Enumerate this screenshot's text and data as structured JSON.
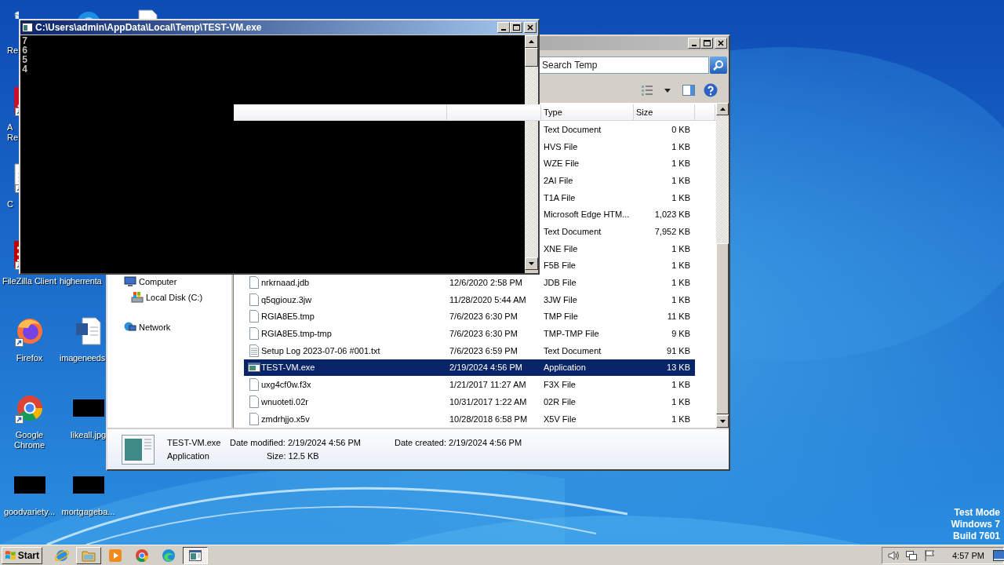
{
  "desktop": {
    "icons": [
      {
        "kind": "recycle-bin",
        "lines": [
          "Re"
        ],
        "clipped": true,
        "shortcut": false
      },
      {
        "kind": "blue-app",
        "shortcut": false
      },
      {
        "kind": "document",
        "shortcut": false
      },
      {
        "kind": "acrobat",
        "lines": [
          "A",
          "Re"
        ],
        "clipped": true,
        "shortcut": true
      },
      {
        "kind": "document",
        "lines": [
          "C"
        ],
        "clipped": true,
        "shortcut": true
      },
      {
        "kind": "filezilla",
        "lines": [
          "FileZilla Client"
        ],
        "clipped": false,
        "shortcut": true
      },
      {
        "lines": [
          "higherrenta"
        ],
        "clipped": true,
        "shortcut": false
      },
      {
        "kind": "firefox",
        "lines": [
          "Firefox"
        ],
        "clipped": false,
        "shortcut": true
      },
      {
        "kind": "word-doc",
        "lines": [
          "imageneeds"
        ],
        "clipped": true,
        "shortcut": false
      },
      {
        "kind": "chrome",
        "lines": [
          "Google",
          "Chrome"
        ],
        "clipped": false,
        "shortcut": true
      },
      {
        "kind": "black-thumb",
        "lines": [
          "likeall.jpg"
        ],
        "clipped": false,
        "shortcut": false
      },
      {
        "kind": "black-thumb",
        "lines": [
          "goodvariety..."
        ],
        "clipped": false,
        "shortcut": false
      },
      {
        "kind": "black-thumb",
        "lines": [
          "mortgageba..."
        ],
        "clipped": false,
        "shortcut": false
      }
    ],
    "notice": [
      "Test Mode",
      "Windows 7",
      "Build 7601"
    ]
  },
  "explorer_window": {
    "search": {
      "placeholder": "Search Temp"
    },
    "navigation": [
      {
        "label": "Computer",
        "kind": "computer",
        "children": [
          {
            "label": "Local Disk (C:)",
            "kind": "disk"
          }
        ]
      },
      {
        "label": "Network",
        "kind": "network"
      }
    ],
    "columns": [
      "Type",
      "Size"
    ],
    "files": [
      {
        "type": "Text Document",
        "size": "0 KB",
        "selected": false
      },
      {
        "type": "HVS File",
        "size": "1 KB",
        "selected": false
      },
      {
        "type": "WZE File",
        "size": "1 KB",
        "selected": false
      },
      {
        "type": "2AI File",
        "size": "1 KB",
        "selected": false
      },
      {
        "type": "T1A File",
        "size": "1 KB",
        "selected": false
      },
      {
        "type": "Microsoft Edge HTM...",
        "size": "1,023 KB",
        "selected": false
      },
      {
        "type": "Text Document",
        "size": "7,952 KB",
        "selected": false
      },
      {
        "type": "XNE File",
        "size": "1 KB",
        "selected": false
      },
      {
        "type": "F5B File",
        "size": "1 KB",
        "selected": false
      },
      {
        "kind": "blank",
        "name": "nrkrnaad.jdb",
        "date": "12/6/2020 2:58 PM",
        "type": "JDB File",
        "size": "1 KB",
        "selected": false
      },
      {
        "kind": "blank",
        "name": "q5qgiouz.3jw",
        "date": "11/28/2020 5:44 AM",
        "type": "3JW File",
        "size": "1 KB",
        "selected": false
      },
      {
        "kind": "blank",
        "name": "RGIA8E5.tmp",
        "date": "7/6/2023 6:30 PM",
        "type": "TMP File",
        "size": "11 KB",
        "selected": false
      },
      {
        "kind": "blank",
        "name": "RGIA8E5.tmp-tmp",
        "date": "7/6/2023 6:30 PM",
        "type": "TMP-TMP File",
        "size": "9 KB",
        "selected": false
      },
      {
        "kind": "text",
        "name": "Setup Log 2023-07-06 #001.txt",
        "date": "7/6/2023 6:59 PM",
        "type": "Text Document",
        "size": "91 KB",
        "selected": false
      },
      {
        "kind": "app",
        "name": "TEST-VM.exe",
        "date": "2/19/2024 4:56 PM",
        "type": "Application",
        "size": "13 KB",
        "selected": true
      },
      {
        "kind": "blank",
        "name": "uxg4cf0w.f3x",
        "date": "1/21/2017 11:27 AM",
        "type": "F3X File",
        "size": "1 KB",
        "selected": false
      },
      {
        "kind": "blank",
        "name": "wnuoteti.02r",
        "date": "10/31/2017 1:22 AM",
        "type": "02R File",
        "size": "1 KB",
        "selected": false
      },
      {
        "kind": "blank",
        "name": "zmdrhjjo.x5v",
        "date": "10/28/2018 6:58 PM",
        "type": "X5V File",
        "size": "1 KB",
        "selected": false
      }
    ],
    "details": {
      "name": "TEST-VM.exe",
      "modified": "Date modified: 2/19/2024 4:56 PM",
      "created": "Date created: 2/19/2024 4:56 PM",
      "type": "Application",
      "size": "Size: 12.5 KB"
    }
  },
  "console_window": {
    "title": "C:\\Users\\admin\\AppData\\Local\\Temp\\TEST-VM.exe",
    "lines": [
      "7",
      "6",
      "5",
      "4"
    ]
  },
  "taskbar": {
    "start": "Start",
    "buttons": [
      {
        "kind": "ie",
        "running": false,
        "selected": false
      },
      {
        "kind": "folder",
        "running": true,
        "selected": false
      },
      {
        "kind": "media",
        "running": false,
        "selected": false
      },
      {
        "kind": "chrome",
        "running": false,
        "selected": false
      },
      {
        "kind": "edge",
        "running": false,
        "selected": false
      },
      {
        "kind": "console",
        "running": true,
        "selected": true
      }
    ],
    "clock": "4:57 PM"
  }
}
